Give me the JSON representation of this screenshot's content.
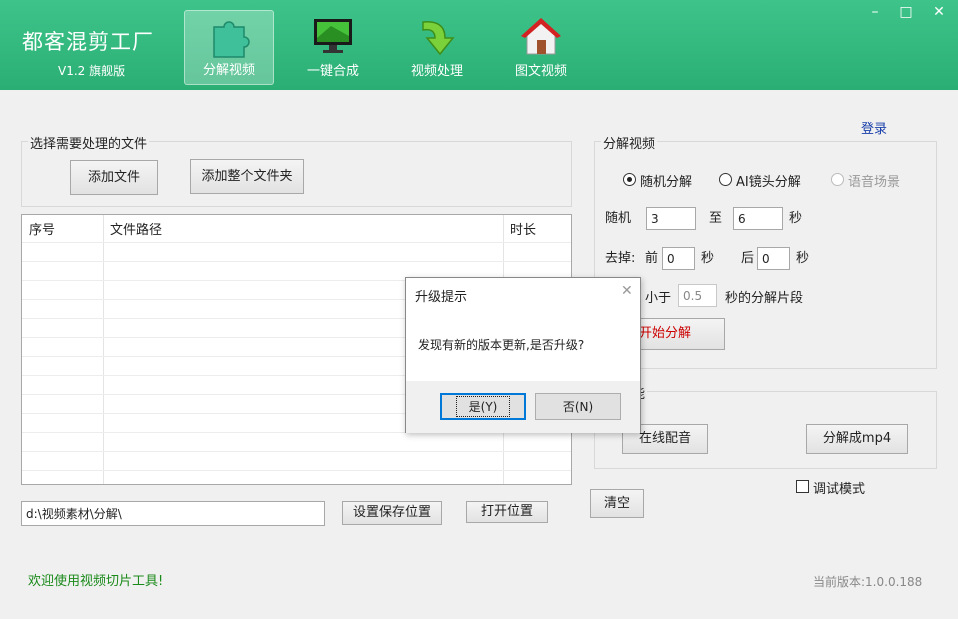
{
  "app": {
    "title": "都客混剪工厂",
    "version": "V1.2 旗舰版"
  },
  "nav": [
    {
      "label": "分解视频",
      "icon": "puzzle-icon",
      "active": true
    },
    {
      "label": "一键合成",
      "icon": "monitor-icon",
      "active": false
    },
    {
      "label": "视频处理",
      "icon": "green-arrow-icon",
      "active": false
    },
    {
      "label": "图文视频",
      "icon": "house-icon",
      "active": false
    }
  ],
  "window": {
    "minimize": "–",
    "maximize": "□",
    "close": "✕"
  },
  "login": "登录",
  "file_group": {
    "title": "选择需要处理的文件",
    "add_file": "添加文件",
    "add_folder": "添加整个文件夹"
  },
  "table": {
    "headers": [
      "序号",
      "文件路径",
      "时长"
    ],
    "rows": []
  },
  "save_path": {
    "value": "d:\\视频素材\\分解\\",
    "set_button": "设置保存位置",
    "open_button": "打开位置"
  },
  "split_group": {
    "title": "分解视频",
    "modes": [
      "随机分解",
      "AI镜头分解",
      "语音场景"
    ],
    "random_label": "随机",
    "random_from": "3",
    "to_label": "至",
    "random_to": "6",
    "seconds": "秒",
    "trim_label": "去掉:",
    "front_label": "前",
    "front_value": "0",
    "back_label": "后",
    "back_value": "0",
    "less_than_label": "小于",
    "less_than_value": "0.5",
    "less_than_suffix": "秒的分解片段",
    "start_button": "开始分解"
  },
  "func_group": {
    "title_fragment": "能",
    "dub_button": "在线配音",
    "mp4_button": "分解成mp4"
  },
  "clear_button": "清空",
  "debug_mode": "调试模式",
  "status": {
    "welcome": "欢迎使用视频切片工具!",
    "current_version": "当前版本:1.0.0.188"
  },
  "dialog": {
    "title": "升级提示",
    "message": "发现有新的版本更新,是否升级?",
    "yes": "是(Y)",
    "no": "否(N)"
  },
  "colors": {
    "header_green": "#2aae74",
    "welcome_green": "#1a8a1a",
    "login_blue": "#1a3faa",
    "start_red": "#cc0000"
  }
}
